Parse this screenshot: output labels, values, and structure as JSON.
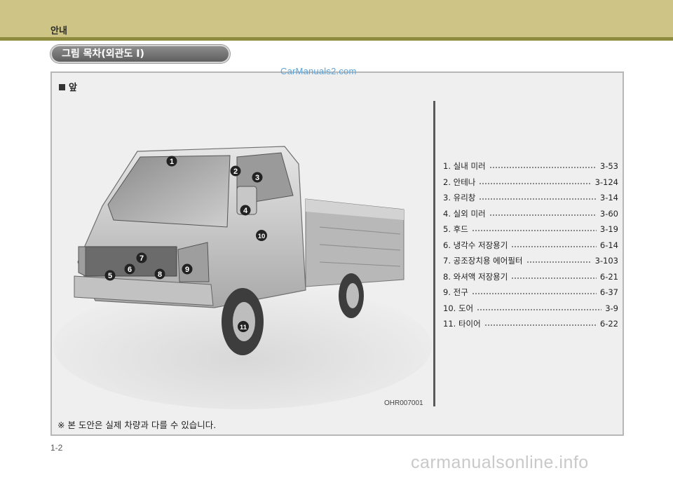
{
  "header": {
    "section": "안내"
  },
  "title": "그림 목차(외관도 I)",
  "watermark": "CarManuals2.com",
  "panel": {
    "heading": "앞",
    "image_code": "OHR007001",
    "note": "※ 본 도안은 실제 차량과 다를 수 있습니다."
  },
  "callouts": [
    {
      "num": "1"
    },
    {
      "num": "2"
    },
    {
      "num": "3"
    },
    {
      "num": "4"
    },
    {
      "num": "5"
    },
    {
      "num": "6"
    },
    {
      "num": "7"
    },
    {
      "num": "8"
    },
    {
      "num": "9"
    },
    {
      "num": "10"
    },
    {
      "num": "11"
    }
  ],
  "toc": [
    {
      "label": "1. 실내 미러",
      "page": "3-53"
    },
    {
      "label": "2. 안테나",
      "page": "3-124"
    },
    {
      "label": "3. 유리창",
      "page": "3-14"
    },
    {
      "label": "4. 실외 미러",
      "page": "3-60"
    },
    {
      "label": "5. 후드",
      "page": "3-19"
    },
    {
      "label": "6. 냉각수 저장용기",
      "page": "6-14"
    },
    {
      "label": "7. 공조장치용 에어필터",
      "page": "3-103"
    },
    {
      "label": "8. 와셔액 저장용기",
      "page": "6-21"
    },
    {
      "label": "9. 전구",
      "page": "6-37"
    },
    {
      "label": "10. 도어",
      "page": "3-9"
    },
    {
      "label": "11. 타이어",
      "page": "6-22"
    }
  ],
  "footer": {
    "page_number": "1-2",
    "watermark": "carmanualsonline.info"
  }
}
